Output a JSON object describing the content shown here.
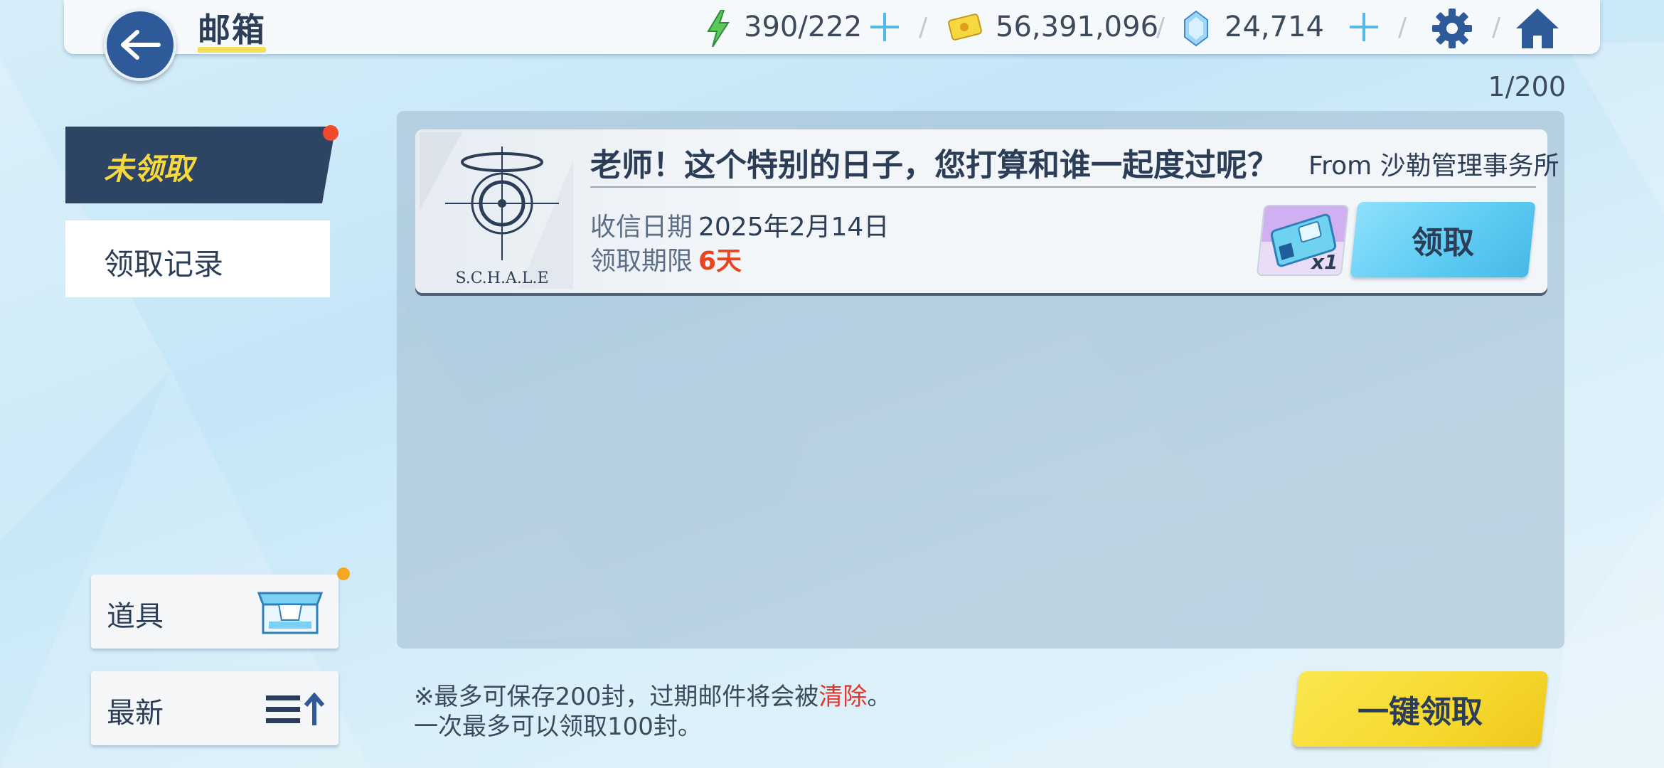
{
  "header": {
    "title": "邮箱",
    "ap": "390/222",
    "credits": "56,391,096",
    "gems": "24,714",
    "separator": "/"
  },
  "mailbox": {
    "count": "1/200"
  },
  "tabs": {
    "unclaimed": "未领取",
    "history": "领取记录"
  },
  "mail": {
    "subject": "老师！这个特别的日子，您打算和谁一起度过呢？",
    "sender": "From 沙勒管理事务所",
    "logo_text": "S.C.H.A.L.E",
    "received_label": "收信日期",
    "received_value": "2025年2月14日",
    "deadline_label": "领取期限",
    "deadline_value": "6天",
    "reward_qty": "x1",
    "reward_icon": "ticket-icon",
    "claim_label": "领取"
  },
  "filters": {
    "items_label": "道具",
    "sort_label": "最新"
  },
  "notice": {
    "line1_prefix": "※最多可保存200封，过期邮件将会被",
    "line1_warn": "清除",
    "line1_suffix": "。",
    "line2": "一次最多可以领取100封。"
  },
  "claim_all_label": "一键领取",
  "colors": {
    "accent_navy": "#2d4563",
    "tab_text_active": "#f5d83e",
    "claim_blue": "#5bcbf3",
    "claim_all_yellow": "#f6d92f",
    "deadline_red": "#e8451e"
  }
}
